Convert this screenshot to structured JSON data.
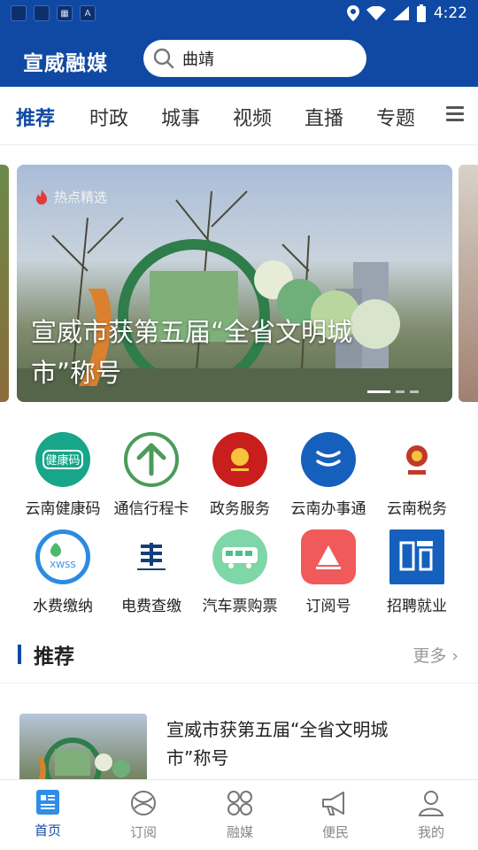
{
  "status": {
    "time": "4:22"
  },
  "header": {
    "brand": "宣威融媒",
    "search_query": "曲靖"
  },
  "tabs": [
    {
      "label": "推荐",
      "active": true
    },
    {
      "label": "时政"
    },
    {
      "label": "城事"
    },
    {
      "label": "视频"
    },
    {
      "label": "直播"
    },
    {
      "label": "专题"
    }
  ],
  "banner": {
    "tag": "热点精选",
    "title": "宣威市获第五届“全省文明城市”称号"
  },
  "services": [
    {
      "label": "云南健康码",
      "icon": "health-code-icon",
      "color": "#17a689"
    },
    {
      "label": "通信行程卡",
      "icon": "travel-card-icon",
      "color": "#4c9b5a"
    },
    {
      "label": "政务服务",
      "icon": "gov-service-icon",
      "color": "#c81e1e"
    },
    {
      "label": "云南办事通",
      "icon": "office-affairs-icon",
      "color": "#1560bd"
    },
    {
      "label": "云南税务",
      "icon": "tax-icon",
      "color": "#c0392b"
    },
    {
      "label": "水费缴纳",
      "icon": "water-fee-icon",
      "color": "#2c8be0"
    },
    {
      "label": "电费查缴",
      "icon": "electricity-fee-icon",
      "color": "#123f7a"
    },
    {
      "label": "汽车票购票",
      "icon": "bus-ticket-icon",
      "color": "#4cbf8a"
    },
    {
      "label": "订阅号",
      "icon": "subscription-icon",
      "color": "#f05a5a"
    },
    {
      "label": "招聘就业",
      "icon": "recruit-icon",
      "color": "#1560bd"
    }
  ],
  "section": {
    "title": "推荐",
    "more": "更多"
  },
  "news": [
    {
      "title": "宣威市获第五届“全省文明城市”称号"
    }
  ],
  "bottom_nav": [
    {
      "label": "首页",
      "active": true
    },
    {
      "label": "订阅"
    },
    {
      "label": "融媒"
    },
    {
      "label": "便民"
    },
    {
      "label": "我的"
    }
  ]
}
